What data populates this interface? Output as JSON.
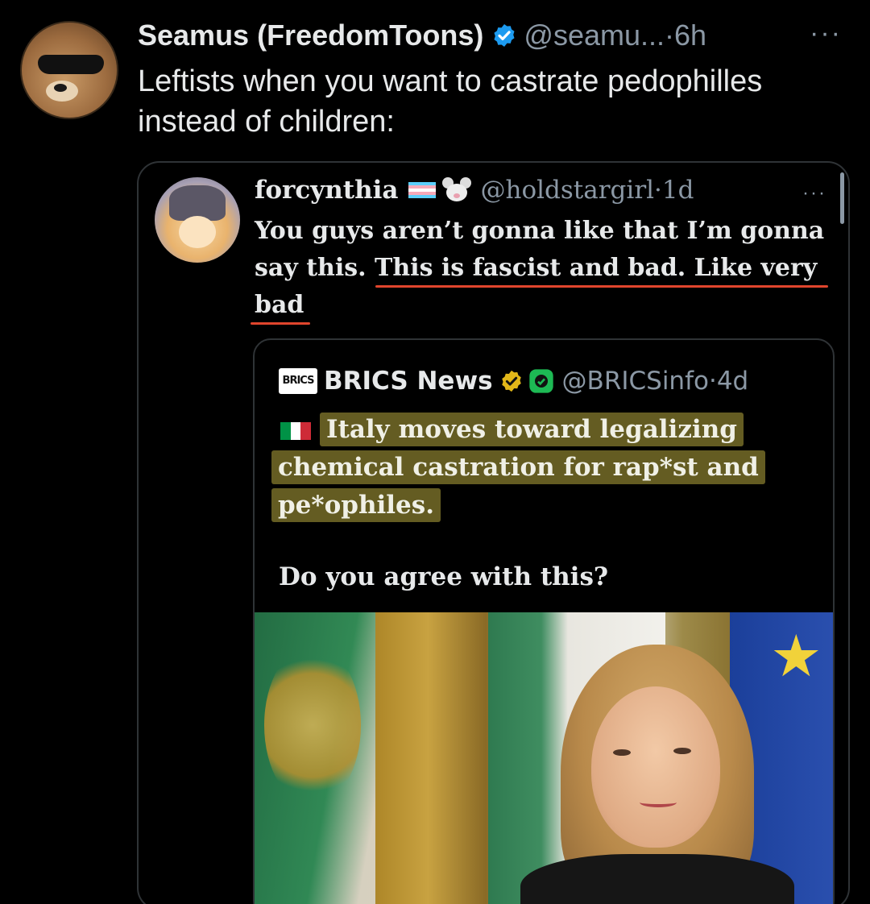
{
  "tweet": {
    "display_name": "Seamus (FreedomToons)",
    "handle": "@seamu...",
    "separator": "·",
    "time": "6h",
    "more": "···",
    "text": "Leftists when you want to castrate pedophilles instead of children:",
    "avatar_icon": "dog-sunglasses-avatar"
  },
  "quote": {
    "display_name": "forcynthia",
    "handle": "@holdstargirl",
    "separator": "·",
    "time": "1d",
    "more": "···",
    "text": "You guys aren’t gonna like that I’m gonna say this. This is fascist and bad. Like very bad",
    "badges": [
      "transgender-flag-icon",
      "mouse-face-icon"
    ]
  },
  "inner_quote": {
    "logo_text": "BRICS",
    "display_name": "BRICS News",
    "handle": "@BRICSinfo",
    "separator": "·",
    "time": "4d",
    "flag": "italy-flag-icon",
    "headline_lines": [
      "Italy moves toward legalizing",
      "chemical castration for rap*st and",
      "pe*ophiles."
    ],
    "question": "Do you agree with this?",
    "colors": {
      "gold_check": "#e2b719",
      "green_badge": "#1db954",
      "highlight": "#766c28"
    }
  },
  "colors": {
    "underline": "#e0452d",
    "verified_blue": "#1d9bf0",
    "secondary_text": "#8b98a5"
  }
}
